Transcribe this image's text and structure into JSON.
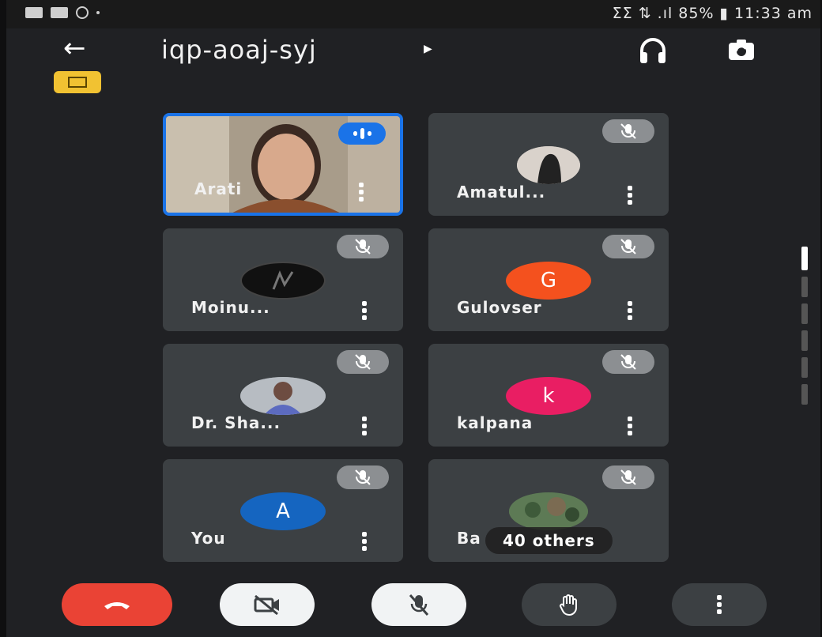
{
  "status_bar": {
    "right_text": "ⵉⵉ ⇅ .ıl 85% ▮ 11:33 am"
  },
  "meeting": {
    "code": "iqp-aoaj-syj"
  },
  "tiles": [
    {
      "name": "Arati"
    },
    {
      "name": "Amatul..."
    },
    {
      "name": "Moinu..."
    },
    {
      "name": "Gulovser",
      "initial": "G"
    },
    {
      "name": "Dr. Sha..."
    },
    {
      "name": "kalpana",
      "initial": "k"
    },
    {
      "name": "You",
      "initial": "A"
    },
    {
      "name": "Ba",
      "overflow_label": "40 others"
    }
  ],
  "colors": {
    "accent": "#1a73e8",
    "end_call": "#ea4335",
    "avatar_g": "#f4511e",
    "avatar_k": "#e91e63",
    "avatar_a": "#1565c0",
    "badge": "#f1c232"
  },
  "icons": [
    "back-arrow-icon",
    "audio-output-icon",
    "switch-camera-icon",
    "mic-off-icon",
    "camera-off-icon",
    "raise-hand-icon",
    "more-vert-icon",
    "end-call-icon"
  ]
}
